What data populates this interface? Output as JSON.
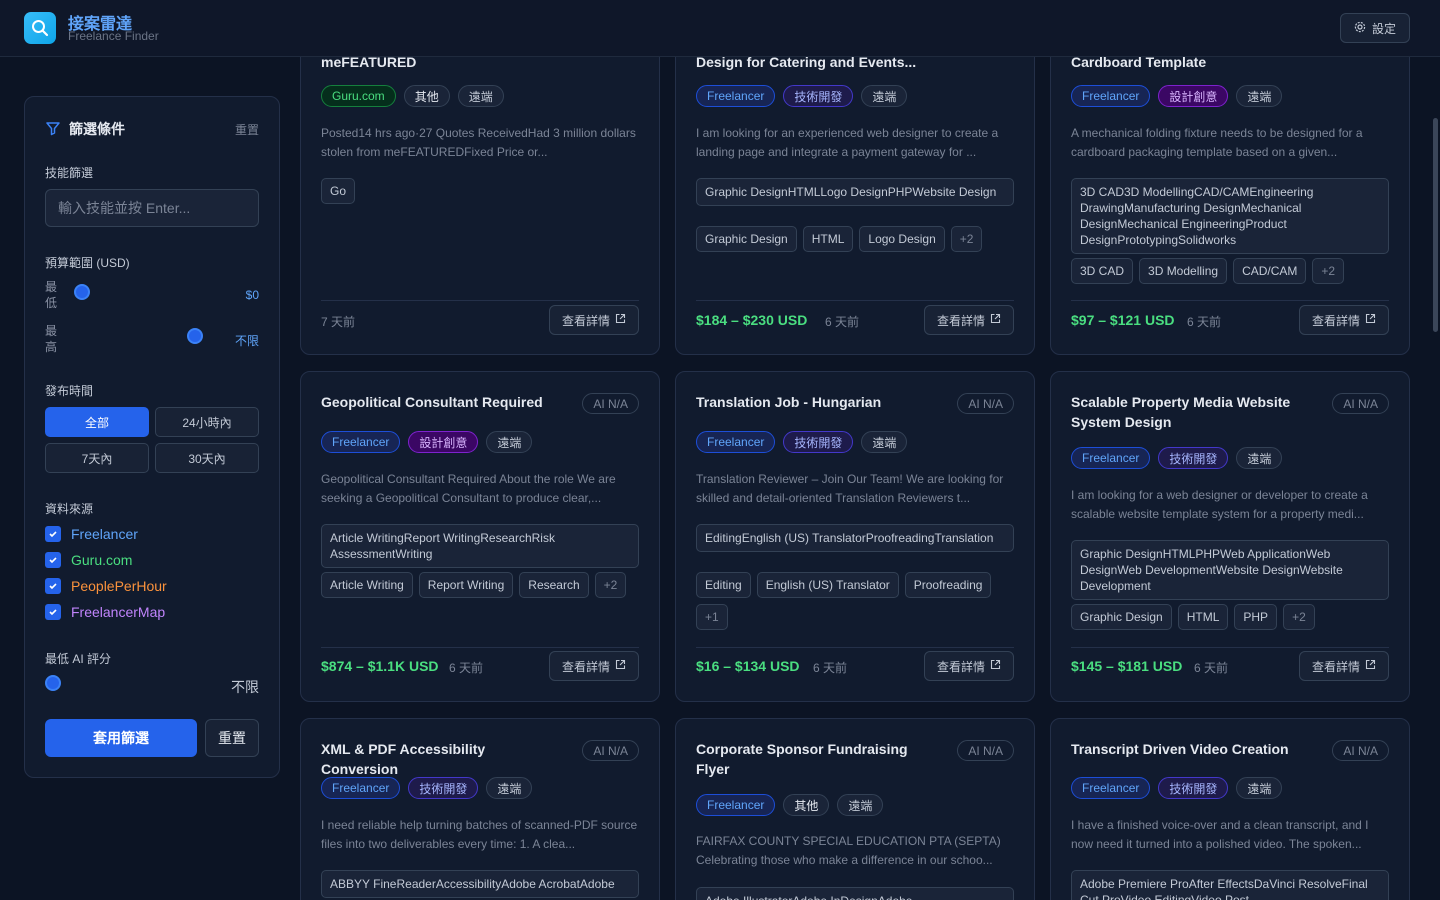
{
  "header": {
    "title": "接案雷達",
    "subtitle": "Freelance Finder",
    "settings_label": "設定"
  },
  "sidebar": {
    "title": "篩選條件",
    "reset_link": "重置",
    "skill_label": "技能篩選",
    "skill_placeholder": "輸入技能並按 Enter...",
    "budget_label": "預算範圍 (USD)",
    "min_label": "最低",
    "min_value": "$0",
    "max_label": "最高",
    "max_value": "不限",
    "time_label": "發布時間",
    "time_options": [
      "全部",
      "24小時內",
      "7天內",
      "30天內"
    ],
    "time_selected": "全部",
    "source_label": "資料來源",
    "sources": [
      {
        "name": "Freelancer",
        "color": "#60a5fa"
      },
      {
        "name": "Guru.com",
        "color": "#4ade80"
      },
      {
        "name": "PeoplePerHour",
        "color": "#fb923c"
      },
      {
        "name": "FreelancerMap",
        "color": "#c084fc"
      }
    ],
    "ai_label": "最低 AI 評分",
    "ai_value": "不限",
    "apply_label": "套用篩選",
    "reset_label": "重置"
  },
  "cards": [
    {
      "title": "meFEATURED",
      "tags": [
        "Guru.com",
        "其他",
        "遠端"
      ],
      "desc": "Posted14 hrs ago·27 Quotes ReceivedHad 3 million dollars stolen from meFEATUREDFixed Price or...",
      "chips": [
        "Go"
      ],
      "age": "7 天前",
      "view_label": "查看詳情"
    },
    {
      "title": "Design for Catering and Events...",
      "tags": [
        "Freelancer",
        "技術開發",
        "遠端"
      ],
      "desc": "I am looking for an experienced web designer to create a landing page and integrate a payment gateway for ...",
      "skills_raw": "Graphic DesignHTMLLogo DesignPHPWebsite Design",
      "chips": [
        "Graphic Design",
        "HTML",
        "Logo Design",
        "+2"
      ],
      "price": "$184 – $230 USD",
      "age": "6 天前",
      "view_label": "查看詳情"
    },
    {
      "title": "Cardboard Template",
      "tags": [
        "Freelancer",
        "設計創意",
        "遠端"
      ],
      "desc": "A mechanical folding fixture needs to be designed for a cardboard packaging template based on a given...",
      "skills_raw": "3D CAD3D ModellingCAD/CAMEngineering DrawingManufacturing DesignMechanical DesignMechanical EngineeringProduct DesignPrototypingSolidworks",
      "chips": [
        "3D CAD",
        "3D Modelling",
        "CAD/CAM",
        "+2"
      ],
      "price": "$97 – $121 USD",
      "age": "6 天前",
      "view_label": "查看詳情"
    },
    {
      "title": "Geopolitical Consultant Required",
      "ai": "AI N/A",
      "tags": [
        "Freelancer",
        "設計創意",
        "遠端"
      ],
      "desc": "Geopolitical Consultant Required About the role We are seeking a Geopolitical Consultant to produce clear,...",
      "skills_raw": "Article WritingReport WritingResearchRisk AssessmentWriting",
      "chips": [
        "Article Writing",
        "Report Writing",
        "Research",
        "+2"
      ],
      "price": "$874 – $1.1K USD",
      "age": "6 天前",
      "view_label": "查看詳情"
    },
    {
      "title": "Translation Job - Hungarian",
      "ai": "AI N/A",
      "tags": [
        "Freelancer",
        "技術開發",
        "遠端"
      ],
      "desc": "Translation Reviewer – Join Our Team! We are looking for skilled and detail-oriented Translation Reviewers t...",
      "skills_raw": "EditingEnglish (US) TranslatorProofreadingTranslation",
      "chips": [
        "Editing",
        "English (US) Translator",
        "Proofreading",
        "+1"
      ],
      "price": "$16 – $134 USD",
      "age": "6 天前",
      "view_label": "查看詳情"
    },
    {
      "title": "Scalable Property Media Website System Design",
      "ai": "AI N/A",
      "tags": [
        "Freelancer",
        "技術開發",
        "遠端"
      ],
      "desc": "I am looking for a web designer or developer to create a scalable website template system for a property medi...",
      "skills_raw": "Graphic DesignHTMLPHPWeb ApplicationWeb DesignWeb DevelopmentWebsite DesignWebsite Development",
      "chips": [
        "Graphic Design",
        "HTML",
        "PHP",
        "+2"
      ],
      "price": "$145 – $181 USD",
      "age": "6 天前",
      "view_label": "查看詳情"
    },
    {
      "title": "XML & PDF Accessibility Conversion",
      "ai": "AI N/A",
      "tags": [
        "Freelancer",
        "技術開發",
        "遠端"
      ],
      "desc": "I need reliable help turning batches of scanned-PDF source files into two deliverables every time: 1. A clea...",
      "skills_raw": "ABBYY FineReaderAccessibilityAdobe AcrobatAdobe"
    },
    {
      "title": "Corporate Sponsor Fundraising Flyer",
      "ai": "AI N/A",
      "tags": [
        "Freelancer",
        "其他",
        "遠端"
      ],
      "desc": "FAIRFAX COUNTY SPECIAL EDUCATION PTA (SEPTA) Celebrating those who make a difference in our schoo...",
      "skills_raw": "Adobe IllustratorAdobe InDesignAdobe"
    },
    {
      "title": "Transcript Driven Video Creation",
      "ai": "AI N/A",
      "tags": [
        "Freelancer",
        "技術開發",
        "遠端"
      ],
      "desc": "I have a finished voice-over and a clean transcript, and I now need it turned into a polished video. The spoken...",
      "skills_raw": "Adobe Premiere ProAfter EffectsDaVinci ResolveFinal Cut ProVideo EditingVideo Post-"
    }
  ],
  "colors": {
    "accent": "#2563eb",
    "price": "#4ade80",
    "background": "#0c1424"
  }
}
